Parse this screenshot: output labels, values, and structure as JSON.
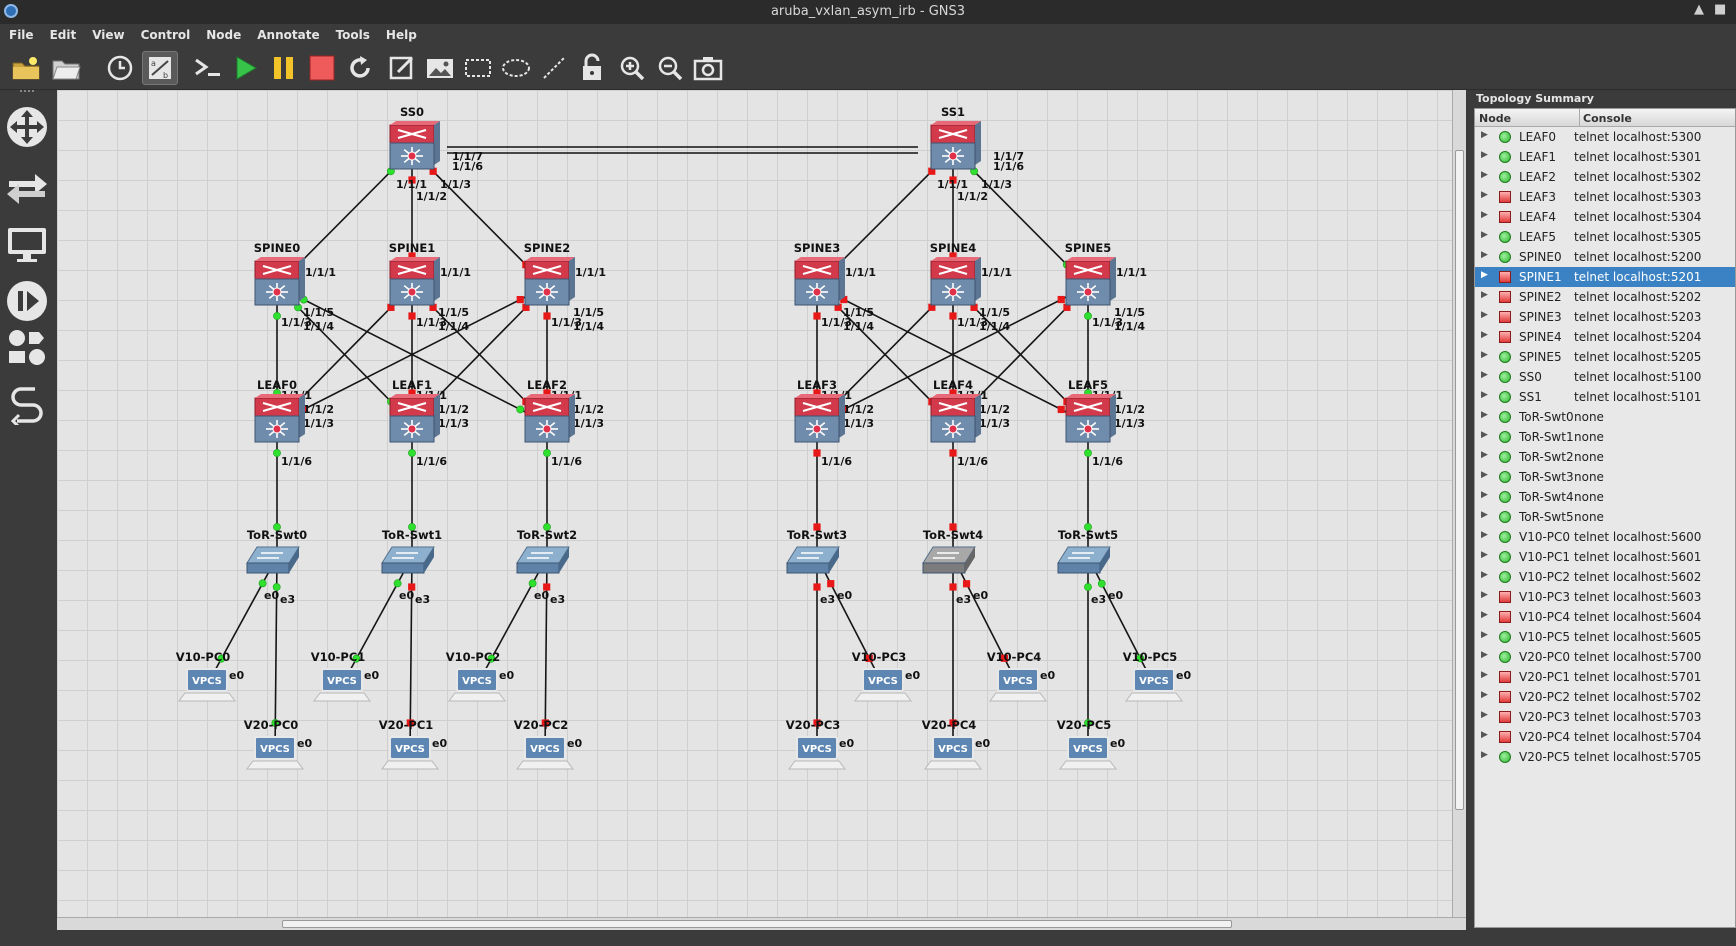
{
  "window": {
    "title": "aruba_vxlan_asym_irb - GNS3"
  },
  "menu": [
    "File",
    "Edit",
    "View",
    "Control",
    "Node",
    "Annotate",
    "Tools",
    "Help"
  ],
  "toolbar": [
    {
      "name": "new-project-icon"
    },
    {
      "name": "open-project-icon"
    },
    {
      "name": "snapshot-clock-icon"
    },
    {
      "name": "show-interface-labels-icon"
    },
    {
      "name": "console-all-icon"
    },
    {
      "name": "start-all-icon"
    },
    {
      "name": "suspend-all-icon"
    },
    {
      "name": "stop-all-icon"
    },
    {
      "name": "reload-all-icon"
    },
    {
      "name": "add-note-icon"
    },
    {
      "name": "insert-image-icon"
    },
    {
      "name": "draw-rectangle-icon"
    },
    {
      "name": "draw-ellipse-icon"
    },
    {
      "name": "draw-line-icon"
    },
    {
      "name": "lock-icon"
    },
    {
      "name": "zoom-in-icon"
    },
    {
      "name": "zoom-out-icon"
    },
    {
      "name": "screenshot-icon"
    }
  ],
  "summary": {
    "title": "Topology Summary",
    "col_node": "Node",
    "col_console": "Console",
    "rows": [
      {
        "node": "LEAF0",
        "console": "telnet localhost:5300",
        "status": "on"
      },
      {
        "node": "LEAF1",
        "console": "telnet localhost:5301",
        "status": "on"
      },
      {
        "node": "LEAF2",
        "console": "telnet localhost:5302",
        "status": "on"
      },
      {
        "node": "LEAF3",
        "console": "telnet localhost:5303",
        "status": "off"
      },
      {
        "node": "LEAF4",
        "console": "telnet localhost:5304",
        "status": "off"
      },
      {
        "node": "LEAF5",
        "console": "telnet localhost:5305",
        "status": "on"
      },
      {
        "node": "SPINE0",
        "console": "telnet localhost:5200",
        "status": "on"
      },
      {
        "node": "SPINE1",
        "console": "telnet localhost:5201",
        "status": "off",
        "selected": true
      },
      {
        "node": "SPINE2",
        "console": "telnet localhost:5202",
        "status": "off"
      },
      {
        "node": "SPINE3",
        "console": "telnet localhost:5203",
        "status": "off"
      },
      {
        "node": "SPINE4",
        "console": "telnet localhost:5204",
        "status": "off"
      },
      {
        "node": "SPINE5",
        "console": "telnet localhost:5205",
        "status": "on"
      },
      {
        "node": "SS0",
        "console": "telnet localhost:5100",
        "status": "on"
      },
      {
        "node": "SS1",
        "console": "telnet localhost:5101",
        "status": "on"
      },
      {
        "node": "ToR-Swt0",
        "console": "none",
        "status": "on"
      },
      {
        "node": "ToR-Swt1",
        "console": "none",
        "status": "on"
      },
      {
        "node": "ToR-Swt2",
        "console": "none",
        "status": "on"
      },
      {
        "node": "ToR-Swt3",
        "console": "none",
        "status": "on"
      },
      {
        "node": "ToR-Swt4",
        "console": "none",
        "status": "on"
      },
      {
        "node": "ToR-Swt5",
        "console": "none",
        "status": "on"
      },
      {
        "node": "V10-PC0",
        "console": "telnet localhost:5600",
        "status": "on"
      },
      {
        "node": "V10-PC1",
        "console": "telnet localhost:5601",
        "status": "on"
      },
      {
        "node": "V10-PC2",
        "console": "telnet localhost:5602",
        "status": "on"
      },
      {
        "node": "V10-PC3",
        "console": "telnet localhost:5603",
        "status": "off"
      },
      {
        "node": "V10-PC4",
        "console": "telnet localhost:5604",
        "status": "off"
      },
      {
        "node": "V10-PC5",
        "console": "telnet localhost:5605",
        "status": "on"
      },
      {
        "node": "V20-PC0",
        "console": "telnet localhost:5700",
        "status": "on"
      },
      {
        "node": "V20-PC1",
        "console": "telnet localhost:5701",
        "status": "off"
      },
      {
        "node": "V20-PC2",
        "console": "telnet localhost:5702",
        "status": "off"
      },
      {
        "node": "V20-PC3",
        "console": "telnet localhost:5703",
        "status": "off"
      },
      {
        "node": "V20-PC4",
        "console": "telnet localhost:5704",
        "status": "off"
      },
      {
        "node": "V20-PC5",
        "console": "telnet localhost:5705",
        "status": "on"
      }
    ]
  },
  "topology": {
    "vpcs_label": "VPCS",
    "nodes": [
      {
        "id": "SS0",
        "kind": "router",
        "label": "SS0"
      },
      {
        "id": "SS1",
        "kind": "router",
        "label": "SS1"
      },
      {
        "id": "SPINE0",
        "kind": "router",
        "label": "SPINE0"
      },
      {
        "id": "SPINE1",
        "kind": "router",
        "label": "SPINE1"
      },
      {
        "id": "SPINE2",
        "kind": "router",
        "label": "SPINE2"
      },
      {
        "id": "SPINE3",
        "kind": "router",
        "label": "SPINE3"
      },
      {
        "id": "SPINE4",
        "kind": "router",
        "label": "SPINE4"
      },
      {
        "id": "SPINE5",
        "kind": "router",
        "label": "SPINE5"
      },
      {
        "id": "LEAF0",
        "kind": "router",
        "label": "LEAF0"
      },
      {
        "id": "LEAF1",
        "kind": "router",
        "label": "LEAF1"
      },
      {
        "id": "LEAF2",
        "kind": "router",
        "label": "LEAF2"
      },
      {
        "id": "LEAF3",
        "kind": "router",
        "label": "LEAF3"
      },
      {
        "id": "LEAF4",
        "kind": "router",
        "label": "LEAF4"
      },
      {
        "id": "LEAF5",
        "kind": "router",
        "label": "LEAF5"
      },
      {
        "id": "ToR-Swt0",
        "kind": "switch",
        "label": "ToR-Swt0"
      },
      {
        "id": "ToR-Swt1",
        "kind": "switch",
        "label": "ToR-Swt1"
      },
      {
        "id": "ToR-Swt2",
        "kind": "switch",
        "label": "ToR-Swt2"
      },
      {
        "id": "ToR-Swt3",
        "kind": "switch",
        "label": "ToR-Swt3"
      },
      {
        "id": "ToR-Swt4",
        "kind": "switch",
        "label": "ToR-Swt4"
      },
      {
        "id": "ToR-Swt5",
        "kind": "switch",
        "label": "ToR-Swt5"
      },
      {
        "id": "V10-PC0",
        "kind": "pc",
        "label": "V10-PC0"
      },
      {
        "id": "V10-PC1",
        "kind": "pc",
        "label": "V10-PC1"
      },
      {
        "id": "V10-PC2",
        "kind": "pc",
        "label": "V10-PC2"
      },
      {
        "id": "V10-PC3",
        "kind": "pc",
        "label": "V10-PC3"
      },
      {
        "id": "V10-PC4",
        "kind": "pc",
        "label": "V10-PC4"
      },
      {
        "id": "V10-PC5",
        "kind": "pc",
        "label": "V10-PC5"
      },
      {
        "id": "V20-PC0",
        "kind": "pc",
        "label": "V20-PC0"
      },
      {
        "id": "V20-PC1",
        "kind": "pc",
        "label": "V20-PC1"
      },
      {
        "id": "V20-PC2",
        "kind": "pc",
        "label": "V20-PC2"
      },
      {
        "id": "V20-PC3",
        "kind": "pc",
        "label": "V20-PC3"
      },
      {
        "id": "V20-PC4",
        "kind": "pc",
        "label": "V20-PC4"
      },
      {
        "id": "V20-PC5",
        "kind": "pc",
        "label": "V20-PC5"
      }
    ],
    "links": [
      [
        "SS0",
        "SS1"
      ],
      [
        "SS0",
        "SPINE0"
      ],
      [
        "SS0",
        "SPINE1"
      ],
      [
        "SS0",
        "SPINE2"
      ],
      [
        "SS1",
        "SPINE3"
      ],
      [
        "SS1",
        "SPINE4"
      ],
      [
        "SS1",
        "SPINE5"
      ],
      [
        "SPINE0",
        "LEAF0"
      ],
      [
        "SPINE0",
        "LEAF1"
      ],
      [
        "SPINE0",
        "LEAF2"
      ],
      [
        "SPINE1",
        "LEAF0"
      ],
      [
        "SPINE1",
        "LEAF1"
      ],
      [
        "SPINE1",
        "LEAF2"
      ],
      [
        "SPINE2",
        "LEAF0"
      ],
      [
        "SPINE2",
        "LEAF1"
      ],
      [
        "SPINE2",
        "LEAF2"
      ],
      [
        "SPINE3",
        "LEAF3"
      ],
      [
        "SPINE3",
        "LEAF4"
      ],
      [
        "SPINE3",
        "LEAF5"
      ],
      [
        "SPINE4",
        "LEAF3"
      ],
      [
        "SPINE4",
        "LEAF4"
      ],
      [
        "SPINE4",
        "LEAF5"
      ],
      [
        "SPINE5",
        "LEAF3"
      ],
      [
        "SPINE5",
        "LEAF4"
      ],
      [
        "SPINE5",
        "LEAF5"
      ],
      [
        "LEAF0",
        "ToR-Swt0"
      ],
      [
        "LEAF1",
        "ToR-Swt1"
      ],
      [
        "LEAF2",
        "ToR-Swt2"
      ],
      [
        "LEAF3",
        "ToR-Swt3"
      ],
      [
        "LEAF4",
        "ToR-Swt4"
      ],
      [
        "LEAF5",
        "ToR-Swt5"
      ],
      [
        "ToR-Swt0",
        "V10-PC0"
      ],
      [
        "ToR-Swt0",
        "V20-PC0"
      ],
      [
        "ToR-Swt1",
        "V10-PC1"
      ],
      [
        "ToR-Swt1",
        "V20-PC1"
      ],
      [
        "ToR-Swt2",
        "V10-PC2"
      ],
      [
        "ToR-Swt2",
        "V20-PC2"
      ],
      [
        "ToR-Swt3",
        "V10-PC3"
      ],
      [
        "ToR-Swt3",
        "V20-PC3"
      ],
      [
        "ToR-Swt4",
        "V10-PC4"
      ],
      [
        "ToR-Swt4",
        "V20-PC4"
      ],
      [
        "ToR-Swt5",
        "V10-PC5"
      ],
      [
        "ToR-Swt5",
        "V20-PC5"
      ]
    ],
    "port_labels": [
      "1/1/1",
      "1/1/2",
      "1/1/3",
      "1/1/4",
      "1/1/5",
      "1/1/6",
      "1/1/7",
      "e0",
      "e3"
    ]
  }
}
